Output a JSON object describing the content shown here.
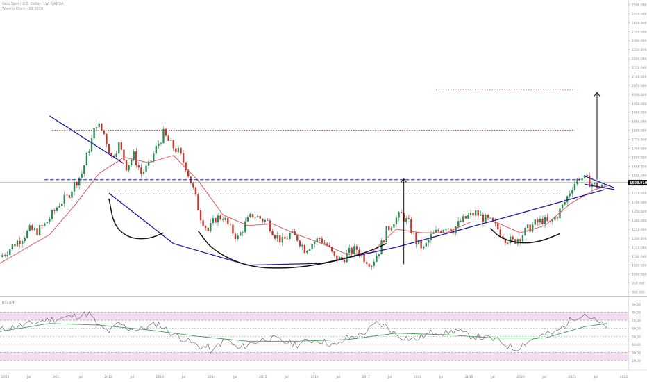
{
  "header": {
    "title": "Gold Spot / U.S. Dollar, 1W, OANDA",
    "subtitle": "Weekly Chart - 11 2019"
  },
  "indicator": {
    "label": "RSI (14)"
  },
  "colors": {
    "candle_up": "#2e8b57",
    "candle_down": "#c0392b",
    "candle_wick": "#555555",
    "ma_line": "#e0474c",
    "trend_blue": "#1a1aa6",
    "pattern_black": "#111111",
    "target_red": "#e03030",
    "rsi_line": "#555555",
    "rsi_ma": "#3f9a50",
    "rsi_band": "#f3ddf0",
    "rsi_band_border": "#c070c0",
    "price_tag_bg": "#111111",
    "price_tag_text": "#ffffff"
  },
  "chart_data": [
    {
      "type": "line",
      "title": "",
      "xlabel": "",
      "ylabel": "",
      "x": [
        "2010",
        "Jul",
        "2011",
        "Jul",
        "2012",
        "Jul",
        "2013",
        "Jul",
        "2014",
        "Jul",
        "2015",
        "Jul",
        "2016",
        "Jul",
        "2017",
        "Jul",
        "2018",
        "Jul",
        "2019",
        "Jul",
        "2020",
        "Jul",
        "2021",
        "Jul",
        "2022"
      ],
      "ylim": [
        875,
        2525
      ],
      "y_ticks": [
        "2500.000",
        "2450.000",
        "2400.000",
        "2350.000",
        "2300.000",
        "2250.000",
        "2200.000",
        "2150.000",
        "2100.000",
        "2050.000",
        "2000.000",
        "1950.000",
        "1900.000",
        "1850.000",
        "1800.000",
        "1750.000",
        "1700.000",
        "1650.000",
        "1600.000",
        "1550.000",
        "1500.000",
        "1450.000",
        "1400.000",
        "1350.000",
        "1300.000",
        "1250.000",
        "1200.000",
        "1150.000",
        "1100.000",
        "1050.000",
        "1000.000",
        "950.000",
        "900.000"
      ],
      "last_price": "1508.910",
      "series": [
        {
          "kind": "ohlc-close",
          "points": [
            [
              0,
              1095
            ],
            [
              1.5,
              1130
            ],
            [
              3,
              1170
            ],
            [
              4.5,
              1205
            ],
            [
              6,
              1245
            ],
            [
              7.5,
              1240
            ],
            [
              9,
              1275
            ],
            [
              10.5,
              1330
            ],
            [
              12,
              1395
            ],
            [
              13.5,
              1425
            ],
            [
              15,
              1500
            ],
            [
              16.5,
              1560
            ],
            [
              18,
              1700
            ],
            [
              19.5,
              1840
            ],
            [
              21,
              1780
            ],
            [
              22.5,
              1650
            ],
            [
              24,
              1720
            ],
            [
              25.5,
              1600
            ],
            [
              27,
              1660
            ],
            [
              28.5,
              1560
            ],
            [
              30,
              1600
            ],
            [
              31.5,
              1700
            ],
            [
              33,
              1780
            ],
            [
              34.5,
              1720
            ],
            [
              36,
              1680
            ],
            [
              37.5,
              1600
            ],
            [
              39,
              1470
            ],
            [
              40.5,
              1320
            ],
            [
              42,
              1240
            ],
            [
              43.5,
              1310
            ],
            [
              45,
              1320
            ],
            [
              46.5,
              1250
            ],
            [
              48,
              1200
            ],
            [
              49.5,
              1280
            ],
            [
              51,
              1330
            ],
            [
              52.5,
              1310
            ],
            [
              54,
              1290
            ],
            [
              55.5,
              1220
            ],
            [
              57,
              1180
            ],
            [
              58.5,
              1220
            ],
            [
              60,
              1200
            ],
            [
              61.5,
              1140
            ],
            [
              63,
              1170
            ],
            [
              64.5,
              1200
            ],
            [
              66,
              1160
            ],
            [
              67.5,
              1090
            ],
            [
              69,
              1080
            ],
            [
              70.5,
              1120
            ],
            [
              72,
              1140
            ],
            [
              73.5,
              1090
            ],
            [
              75,
              1060
            ],
            [
              76.5,
              1130
            ],
            [
              78,
              1240
            ],
            [
              79.5,
              1300
            ],
            [
              81,
              1330
            ],
            [
              82.5,
              1280
            ],
            [
              84,
              1180
            ],
            [
              85.5,
              1140
            ],
            [
              87,
              1210
            ],
            [
              88.5,
              1240
            ],
            [
              90,
              1270
            ],
            [
              91.5,
              1250
            ],
            [
              93,
              1290
            ],
            [
              94.5,
              1320
            ],
            [
              96,
              1340
            ],
            [
              97.5,
              1310
            ],
            [
              99,
              1290
            ],
            [
              100.5,
              1250
            ],
            [
              102,
              1200
            ],
            [
              103.5,
              1180
            ],
            [
              105,
              1210
            ],
            [
              106.5,
              1250
            ],
            [
              108,
              1280
            ],
            [
              109.5,
              1300
            ],
            [
              111,
              1280
            ],
            [
              112.5,
              1330
            ],
            [
              114,
              1400
            ],
            [
              115.5,
              1490
            ],
            [
              117,
              1540
            ],
            [
              118.5,
              1520
            ],
            [
              120,
              1495
            ],
            [
              121.5,
              1480
            ],
            [
              122.5,
              1509
            ]
          ]
        },
        {
          "kind": "moving-average",
          "name": "",
          "points": [
            [
              0,
              1060
            ],
            [
              5,
              1140
            ],
            [
              10,
              1220
            ],
            [
              15,
              1380
            ],
            [
              20,
              1560
            ],
            [
              25,
              1650
            ],
            [
              30,
              1620
            ],
            [
              35,
              1660
            ],
            [
              40,
              1520
            ],
            [
              45,
              1330
            ],
            [
              50,
              1270
            ],
            [
              55,
              1280
            ],
            [
              60,
              1220
            ],
            [
              65,
              1170
            ],
            [
              70,
              1110
            ],
            [
              75,
              1120
            ],
            [
              80,
              1250
            ],
            [
              85,
              1230
            ],
            [
              90,
              1230
            ],
            [
              95,
              1290
            ],
            [
              100,
              1290
            ],
            [
              105,
              1230
            ],
            [
              110,
              1270
            ],
            [
              115,
              1390
            ],
            [
              120,
              1470
            ],
            [
              122.5,
              1490
            ]
          ]
        }
      ],
      "annotations": {
        "resistance_trendline": {
          "from": [
            10,
            1880
          ],
          "to": [
            25,
            1615
          ]
        },
        "neckline_1": {
          "from": [
            9,
            1530
          ],
          "to": [
            66,
            1525
          ]
        },
        "neckline_2": {
          "from": [
            20,
            1445
          ],
          "to": [
            66,
            1445
          ]
        },
        "cup_curve": [
          [
            22,
            1450
          ],
          [
            35,
            1170
          ],
          [
            50,
            1050
          ],
          [
            65,
            1060
          ],
          [
            80,
            1150
          ],
          [
            100,
            1300
          ],
          [
            122,
            1470
          ]
        ],
        "right_wedge": {
          "upper_from": [
            118,
            1545
          ],
          "upper_to": [
            124,
            1470
          ],
          "lower_from": [
            118,
            1470
          ],
          "lower_to": [
            124,
            1500
          ]
        },
        "target_1": 1800,
        "target_2": 2025,
        "measured_move": {
          "x": 81.5,
          "from": 1055,
          "to": 1530
        },
        "projection_arrow": {
          "x": 120.5,
          "from": 1525,
          "to": 2010
        },
        "head_curve": [
          [
            50,
            1160
          ],
          [
            55,
            1080
          ],
          [
            60,
            1040
          ],
          [
            65,
            1060
          ],
          [
            72,
            1105
          ],
          [
            78,
            1140
          ]
        ],
        "left_shoulder_curve": [
          [
            22,
            1420
          ],
          [
            23,
            1270
          ],
          [
            26,
            1200
          ],
          [
            30,
            1195
          ],
          [
            33,
            1230
          ]
        ],
        "right_shoulder_curve": [
          [
            99,
            1255
          ],
          [
            101,
            1200
          ],
          [
            105,
            1170
          ],
          [
            109,
            1180
          ],
          [
            113,
            1225
          ]
        ]
      }
    },
    {
      "type": "line",
      "title": "RSI (14)",
      "ylim": [
        15,
        95
      ],
      "y_ticks": [
        "90.00",
        "80.00",
        "70.00",
        "60.00",
        "50.00",
        "40.00",
        "30.00",
        "20.00"
      ],
      "bands": [
        [
          70,
          80
        ],
        [
          20,
          30
        ]
      ],
      "reference_lines": [
        40,
        50,
        60
      ],
      "series": [
        {
          "kind": "rsi",
          "points": [
            [
              0,
              58
            ],
            [
              3,
              62
            ],
            [
              6,
              65
            ],
            [
              9,
              70
            ],
            [
              12,
              72
            ],
            [
              15,
              75
            ],
            [
              18,
              78
            ],
            [
              20,
              62
            ],
            [
              22,
              56
            ],
            [
              24,
              66
            ],
            [
              26,
              60
            ],
            [
              28,
              58
            ],
            [
              30,
              62
            ],
            [
              32,
              66
            ],
            [
              34,
              56
            ],
            [
              36,
              50
            ],
            [
              38,
              44
            ],
            [
              40,
              38
            ],
            [
              42,
              36
            ],
            [
              43,
              30
            ],
            [
              44,
              40
            ],
            [
              46,
              46
            ],
            [
              48,
              34
            ],
            [
              50,
              40
            ],
            [
              52,
              44
            ],
            [
              54,
              48
            ],
            [
              56,
              46
            ],
            [
              58,
              42
            ],
            [
              60,
              40
            ],
            [
              62,
              44
            ],
            [
              64,
              46
            ],
            [
              66,
              42
            ],
            [
              68,
              38
            ],
            [
              70,
              48
            ],
            [
              72,
              50
            ],
            [
              74,
              56
            ],
            [
              76,
              66
            ],
            [
              78,
              62
            ],
            [
              80,
              52
            ],
            [
              82,
              48
            ],
            [
              84,
              46
            ],
            [
              86,
              52
            ],
            [
              88,
              56
            ],
            [
              90,
              54
            ],
            [
              92,
              58
            ],
            [
              94,
              52
            ],
            [
              96,
              50
            ],
            [
              98,
              48
            ],
            [
              100,
              46
            ],
            [
              102,
              40
            ],
            [
              104,
              34
            ],
            [
              106,
              42
            ],
            [
              108,
              48
            ],
            [
              110,
              52
            ],
            [
              112,
              54
            ],
            [
              114,
              64
            ],
            [
              116,
              74
            ],
            [
              118,
              78
            ],
            [
              120,
              70
            ],
            [
              122,
              62
            ],
            [
              122.5,
              63
            ]
          ]
        },
        {
          "kind": "rsi-ma",
          "points": [
            [
              0,
              56
            ],
            [
              10,
              66
            ],
            [
              20,
              64
            ],
            [
              30,
              58
            ],
            [
              40,
              50
            ],
            [
              50,
              44
            ],
            [
              60,
              44
            ],
            [
              70,
              46
            ],
            [
              80,
              54
            ],
            [
              90,
              52
            ],
            [
              100,
              48
            ],
            [
              110,
              48
            ],
            [
              118,
              62
            ],
            [
              122.5,
              66
            ]
          ]
        }
      ]
    }
  ]
}
